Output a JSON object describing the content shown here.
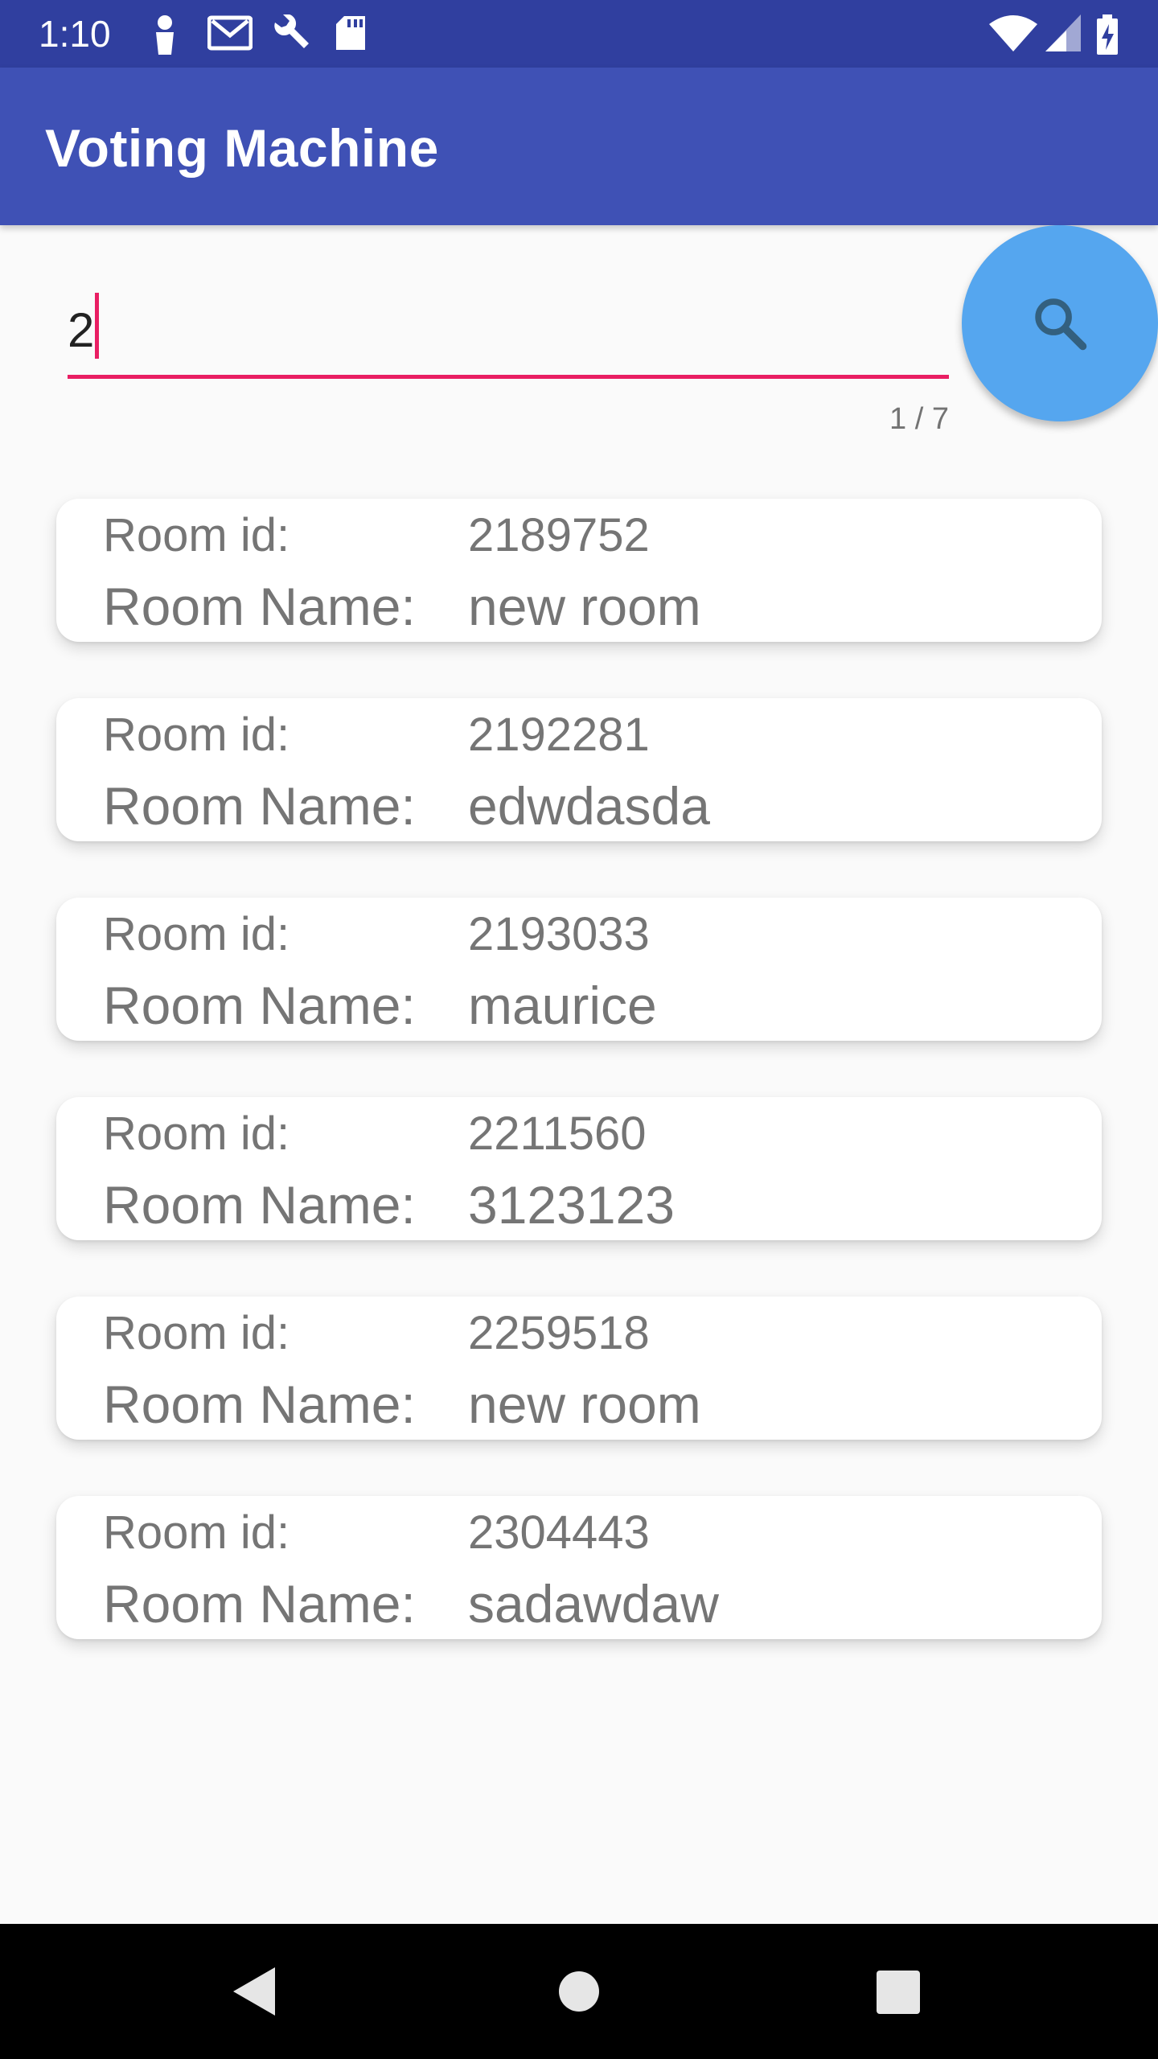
{
  "status_bar": {
    "time": "1:10",
    "left_icons": [
      "person-icon",
      "gmail-icon",
      "wrench-icon",
      "sd-card-icon"
    ],
    "right_icons": [
      "wifi-icon",
      "cell-signal-icon",
      "battery-charging-icon"
    ]
  },
  "app_bar": {
    "title": "Voting Machine"
  },
  "search": {
    "value": "2",
    "counter": "1 / 7",
    "accent_color": "#e91e63",
    "fab_color": "#55a6ef",
    "fab_icon": "search-icon"
  },
  "labels": {
    "room_id": "Room id:",
    "room_name": "Room Name:"
  },
  "rooms": [
    {
      "id": "2189752",
      "name": "new room"
    },
    {
      "id": "2192281",
      "name": "edwdasda"
    },
    {
      "id": "2193033",
      "name": "maurice"
    },
    {
      "id": "2211560",
      "name": "3123123"
    },
    {
      "id": "2259518",
      "name": "new room"
    },
    {
      "id": "2304443",
      "name": "sadawdaw"
    }
  ],
  "nav_bar": {
    "buttons": [
      "back-icon",
      "home-icon",
      "recents-icon"
    ]
  },
  "colors": {
    "status_bar": "#303f9f",
    "app_bar": "#3f51b5",
    "background": "#fafafa"
  }
}
